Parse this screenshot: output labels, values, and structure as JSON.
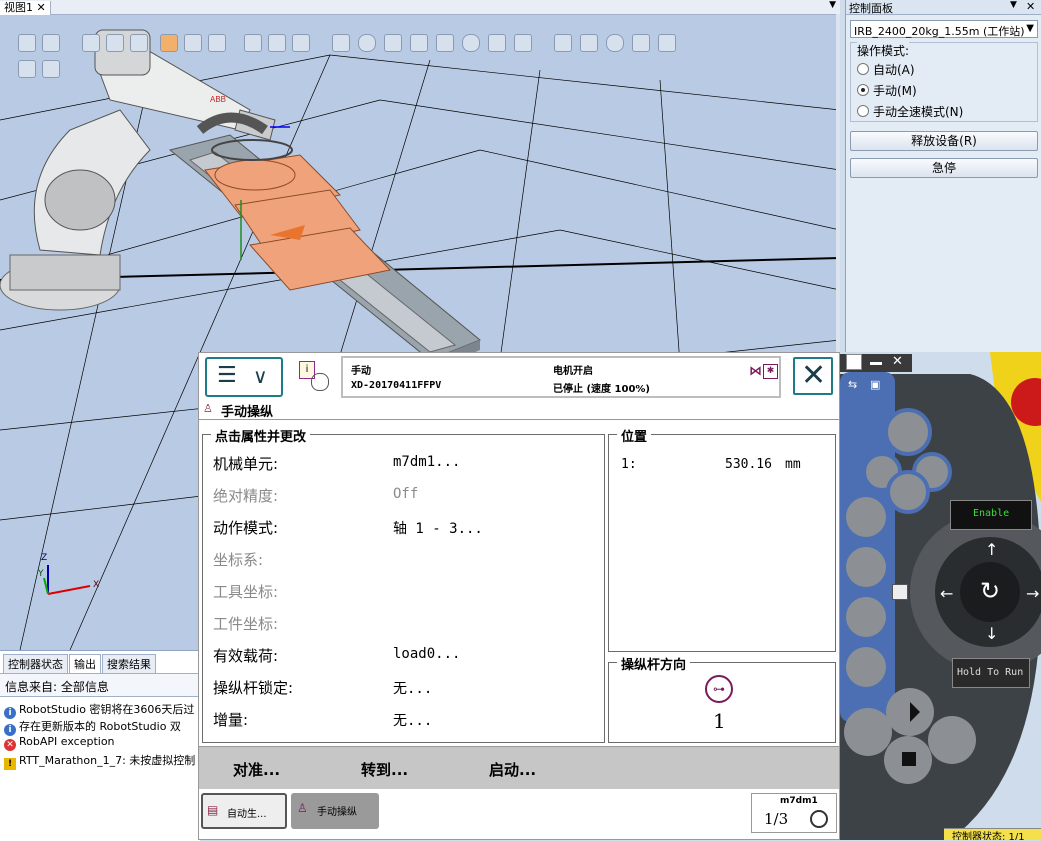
{
  "viewport": {
    "tab_label": "视图1",
    "axes": {
      "z": "Z",
      "y": "Y",
      "x": "X"
    }
  },
  "control_panel": {
    "title": "控制面板",
    "station_select": "IRB_2400_20kg_1.55m (工作站)",
    "mode_group_label": "操作模式:",
    "modes": [
      "自动(A)",
      "手动(M)",
      "手动全速模式(N)"
    ],
    "selected_mode": "手动(M)",
    "release_button": "释放设备(R)",
    "estop_button": "急停"
  },
  "output": {
    "tabs": [
      "控制器状态",
      "输出",
      "搜索结果"
    ],
    "filter": "信息来自: 全部信息",
    "messages": [
      {
        "type": "info",
        "text": "RobotStudio 密钥将在3606天后过"
      },
      {
        "type": "info",
        "text": "存在更新版本的 RobotStudio 双"
      },
      {
        "type": "error",
        "text": "RobAPI exception"
      },
      {
        "type": "warning",
        "text": "RTT_Marathon_1_7: 未按虚拟控制"
      }
    ]
  },
  "flexpendant": {
    "status": {
      "mode": "手动",
      "controller": "XD-20170411FFPV",
      "motor": "电机开启",
      "state": "已停止 (速度 100%)"
    },
    "page_title": "手动操纵",
    "props_title": "点击属性并更改",
    "properties": [
      {
        "label": "机械单元:",
        "value": "m7dm1...",
        "enabled": true
      },
      {
        "label": "绝对精度:",
        "value": "Off",
        "enabled": false
      },
      {
        "label": "动作模式:",
        "value": "轴 1 - 3...",
        "enabled": true
      },
      {
        "label": "坐标系:",
        "value": "",
        "enabled": false
      },
      {
        "label": "工具坐标:",
        "value": "",
        "enabled": false
      },
      {
        "label": "工件坐标:",
        "value": "",
        "enabled": false
      },
      {
        "label": "有效载荷:",
        "value": "load0...",
        "enabled": true
      },
      {
        "label": "操纵杆锁定:",
        "value": "无...",
        "enabled": true
      },
      {
        "label": "增量:",
        "value": "无...",
        "enabled": true
      }
    ],
    "position_title": "位置",
    "position": {
      "index": "1:",
      "value": "530.16",
      "unit": "mm"
    },
    "joystick_title": "操纵杆方向",
    "joystick_value": "1",
    "actions": [
      "对准...",
      "转到...",
      "启动..."
    ],
    "taskbar": [
      "自动生...",
      "手动操纵"
    ],
    "unit_badge": {
      "name": "m7dm1",
      "fraction": "1/3"
    }
  },
  "hardware": {
    "enable_label": "Enable",
    "hold_label": "Hold To Run",
    "status_bar": "控制器状态: 1/1"
  }
}
